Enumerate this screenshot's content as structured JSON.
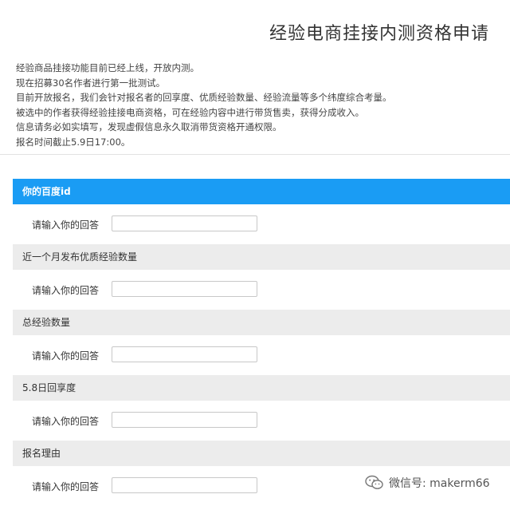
{
  "header": {
    "title": "经验电商挂接内测资格申请",
    "intro_lines": [
      "经验商品挂接功能目前已经上线，开放内测。",
      "现在招募30名作者进行第一批测试。",
      "目前开放报名，我们会针对报名者的回享度、优质经验数量、经验流量等多个纬度综合考量。",
      "被选中的作者获得经验挂接电商资格，可在经验内容中进行带货售卖，获得分成收入。",
      "信息请务必如实填写，发现虚假信息永久取消带货资格开通权限。",
      "报名时间截止5.9日17:00。"
    ]
  },
  "questions": [
    {
      "title": "你的百度id",
      "answer_label": "请输入你的回答",
      "value": ""
    },
    {
      "title": "近一个月发布优质经验数量",
      "answer_label": "请输入你的回答",
      "value": ""
    },
    {
      "title": "总经验数量",
      "answer_label": "请输入你的回答",
      "value": ""
    },
    {
      "title": "5.8日回享度",
      "answer_label": "请输入你的回答",
      "value": ""
    },
    {
      "title": "报名理由",
      "answer_label": "请输入你的回答",
      "value": ""
    }
  ],
  "watermark": {
    "text": "微信号: makerm66",
    "icon": "wechat-icon"
  }
}
